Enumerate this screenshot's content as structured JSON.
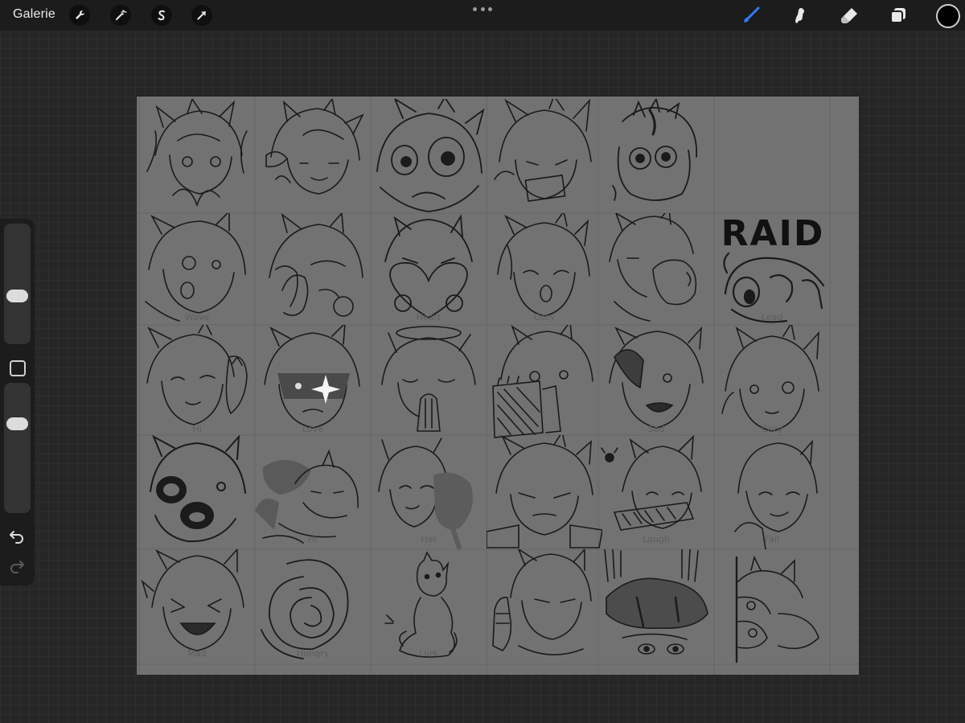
{
  "topbar": {
    "gallery_label": "Galerie",
    "left_tools": [
      {
        "name": "wrench-icon"
      },
      {
        "name": "magic-wand-icon"
      },
      {
        "name": "selection-icon"
      },
      {
        "name": "transform-arrow-icon"
      }
    ],
    "right_tools": [
      {
        "name": "brush-icon",
        "active": true
      },
      {
        "name": "smudge-icon",
        "active": false
      },
      {
        "name": "eraser-icon",
        "active": false
      },
      {
        "name": "layers-icon",
        "active": false
      }
    ],
    "current_color": "#000000",
    "accent_color": "#2f7cf6"
  },
  "sidebar": {
    "brush_size_slider": {
      "level": 0.38
    },
    "opacity_slider": {
      "level": 0.72
    }
  },
  "canvas": {
    "background": "#727272",
    "grid": {
      "rows": 5,
      "cols": 6
    },
    "raid_text": "RAID",
    "faint_labels": [
      "Wave",
      "Heart",
      "Cozy",
      "Lead",
      "Hi",
      "Love",
      "Sad",
      "Cozy",
      "Hi",
      "Hat",
      "Laugh",
      "Fail",
      "Mad",
      "Hungry",
      "Lurk"
    ]
  }
}
